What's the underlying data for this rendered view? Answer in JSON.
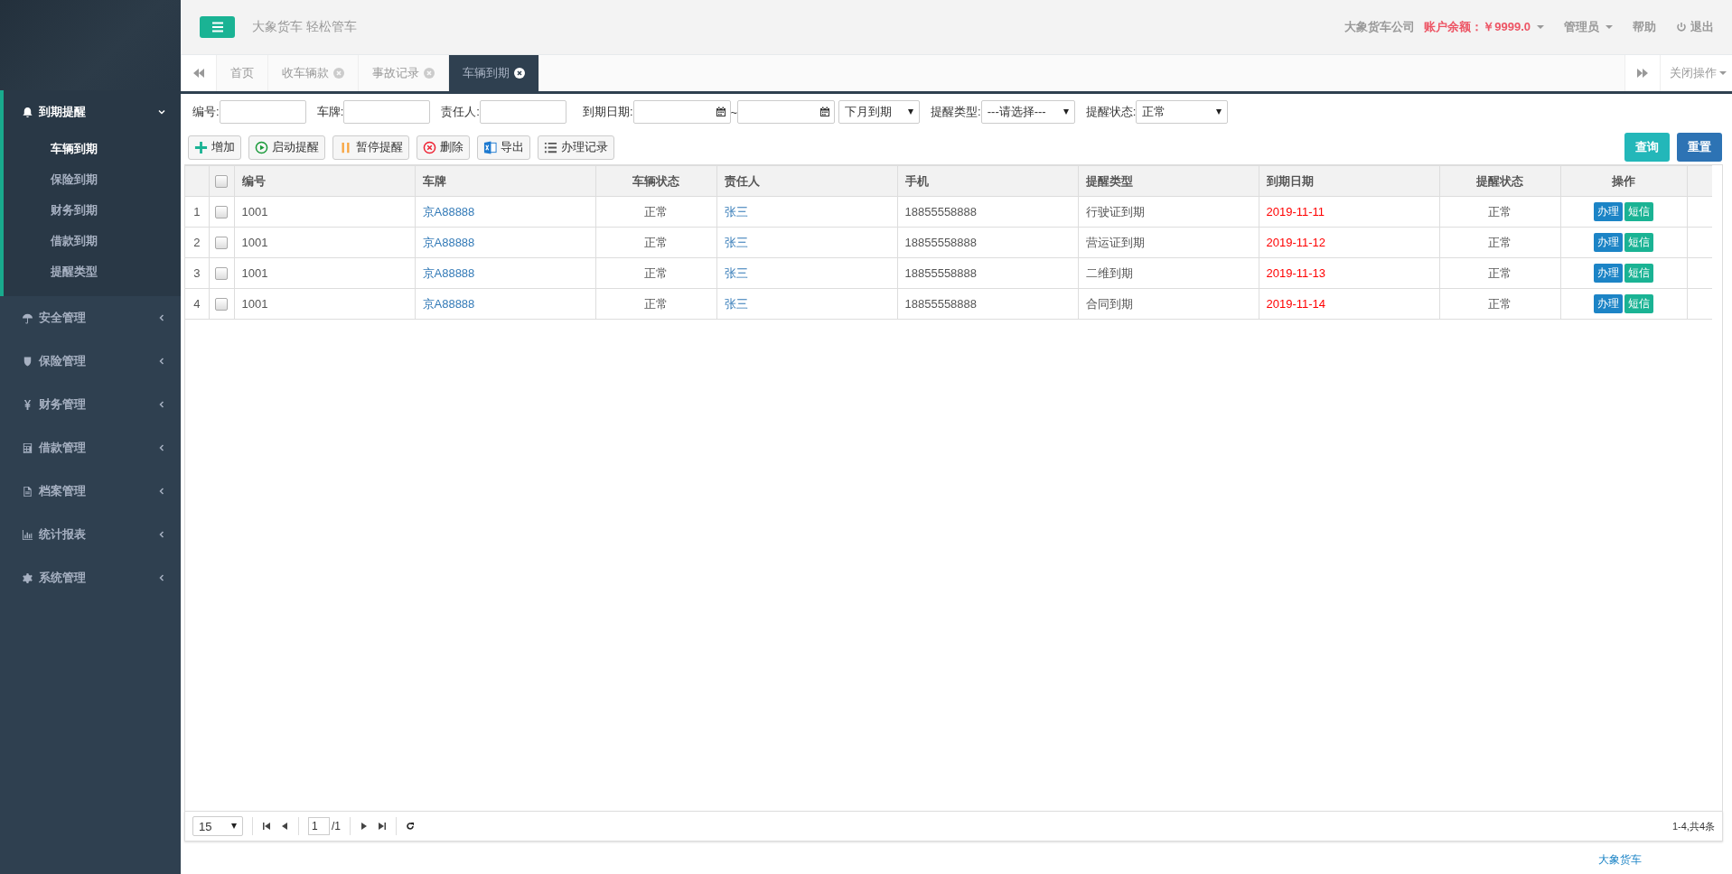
{
  "header": {
    "slogan": "大象货车 轻松管车",
    "company": "大象货车公司",
    "balance": "账户余额：￥9999.0",
    "user": "管理员",
    "help": "帮助",
    "logout": "退出"
  },
  "sidebar": {
    "items": [
      {
        "label": "到期提醒",
        "kind": "bell",
        "expanded": true,
        "children": [
          {
            "label": "车辆到期",
            "selected": true
          },
          {
            "label": "保险到期",
            "selected": false
          },
          {
            "label": "财务到期",
            "selected": false
          },
          {
            "label": "借款到期",
            "selected": false
          },
          {
            "label": "提醒类型",
            "selected": false
          }
        ]
      },
      {
        "label": "安全管理",
        "kind": "umbrella",
        "expanded": false
      },
      {
        "label": "保险管理",
        "kind": "shield",
        "expanded": false
      },
      {
        "label": "财务管理",
        "kind": "yen",
        "expanded": false
      },
      {
        "label": "借款管理",
        "kind": "calculator",
        "expanded": false
      },
      {
        "label": "档案管理",
        "kind": "file",
        "expanded": false
      },
      {
        "label": "统计报表",
        "kind": "chart",
        "expanded": false
      },
      {
        "label": "系统管理",
        "kind": "gear",
        "expanded": false
      }
    ]
  },
  "tabs": [
    {
      "label": "首页",
      "closable": false,
      "selected": false
    },
    {
      "label": "收车辆款",
      "closable": true,
      "selected": false
    },
    {
      "label": "事故记录",
      "closable": true,
      "selected": false
    },
    {
      "label": "车辆到期",
      "closable": true,
      "selected": true
    }
  ],
  "tab_menu": "关闭操作",
  "filters": [
    {
      "kind": "text",
      "label": "编号:"
    },
    {
      "kind": "text",
      "label": "车牌:"
    },
    {
      "kind": "text",
      "label": "责任人:"
    },
    {
      "kind": "daterange",
      "label": "到期日期:",
      "separator": "~"
    },
    {
      "kind": "select",
      "value": "下月到期"
    },
    {
      "kind": "select",
      "label": "提醒类型:",
      "value": "---请选择---"
    },
    {
      "kind": "select",
      "label": "提醒状态:",
      "value": "正常"
    }
  ],
  "toolbar": [
    {
      "label": "增加",
      "kind": "plus"
    },
    {
      "label": "启动提醒",
      "kind": "play"
    },
    {
      "label": "暂停提醒",
      "kind": "pause"
    },
    {
      "label": "删除",
      "kind": "delete"
    },
    {
      "label": "导出",
      "kind": "excel"
    },
    {
      "label": "办理记录",
      "kind": "list"
    }
  ],
  "search_buttons": [
    {
      "label": "查询",
      "kind": "query"
    },
    {
      "label": "重置",
      "kind": "reset"
    }
  ],
  "table": {
    "select_all_checked": false,
    "columns": [
      "编号",
      "车牌",
      "车辆状态",
      "责任人",
      "手机",
      "提醒类型",
      "到期日期",
      "提醒状态",
      "操作"
    ],
    "rows": [
      {
        "index": "1",
        "checked": false,
        "id": "1001",
        "plate": "京A88888",
        "vehicle_status": "正常",
        "owner": "张三",
        "phone": "18855558888",
        "type": "行驶证到期",
        "due": "2019-11-11",
        "status": "正常",
        "actions": [
          "办理",
          "短信"
        ]
      },
      {
        "index": "2",
        "checked": false,
        "id": "1001",
        "plate": "京A88888",
        "vehicle_status": "正常",
        "owner": "张三",
        "phone": "18855558888",
        "type": "营运证到期",
        "due": "2019-11-12",
        "status": "正常",
        "actions": [
          "办理",
          "短信"
        ]
      },
      {
        "index": "3",
        "checked": false,
        "id": "1001",
        "plate": "京A88888",
        "vehicle_status": "正常",
        "owner": "张三",
        "phone": "18855558888",
        "type": "二维到期",
        "due": "2019-11-13",
        "status": "正常",
        "actions": [
          "办理",
          "短信"
        ]
      },
      {
        "index": "4",
        "checked": false,
        "id": "1001",
        "plate": "京A88888",
        "vehicle_status": "正常",
        "owner": "张三",
        "phone": "18855558888",
        "type": "合同到期",
        "due": "2019-11-14",
        "status": "正常",
        "actions": [
          "办理",
          "短信"
        ]
      }
    ]
  },
  "pager": {
    "page_size": "15",
    "page": "1",
    "total_pages": "/1",
    "summary": "1-4,共4条"
  },
  "footer": "大象货车"
}
